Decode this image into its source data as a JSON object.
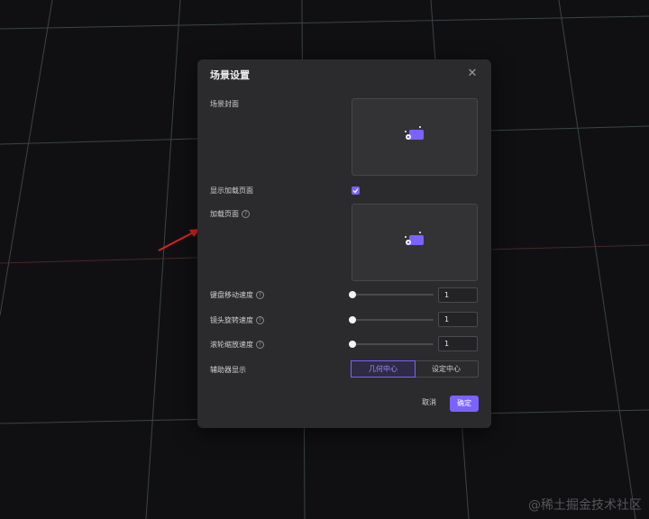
{
  "dialog": {
    "title": "场景设置",
    "close_icon": "close-icon",
    "fields": {
      "cover_label": "场景封面",
      "show_loading_label": "显示加载页面",
      "show_loading_checked": true,
      "loading_page_label": "加载页面",
      "keyboard_speed_label": "键盘移动速度",
      "keyboard_speed_value": "1",
      "lens_rotate_label": "镜头旋转速度",
      "lens_rotate_value": "1",
      "wheel_zoom_label": "滚轮缩放速度",
      "wheel_zoom_value": "1",
      "helper_label": "辅助器显示",
      "helper_options": [
        "几何中心",
        "设定中心"
      ],
      "helper_selected": "几何中心"
    },
    "buttons": {
      "cancel": "取消",
      "confirm": "确定"
    }
  },
  "watermark": "@稀土掘金技术社区",
  "colors": {
    "accent": "#7b62ff",
    "dialog_bg": "#2b2b2e",
    "scene_bg": "#101012",
    "arrow": "#e02020"
  }
}
